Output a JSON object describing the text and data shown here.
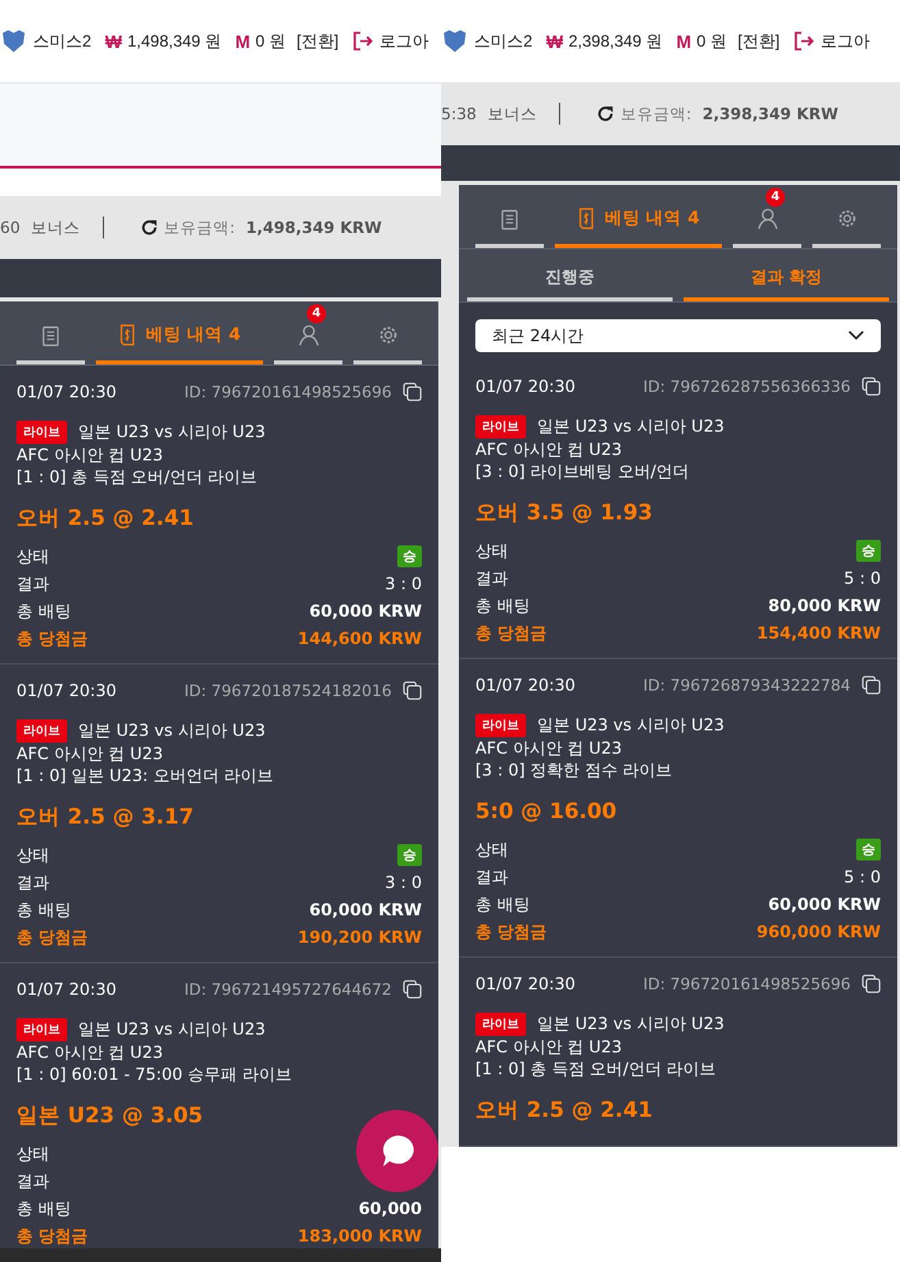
{
  "screens": [
    {
      "top_bar": {
        "username": "스미스2",
        "cash_symbol": "₩",
        "cash": "1,498,349 원",
        "point_symbol": "M",
        "points": "0 원",
        "switch": "[전환]",
        "logout": "로그아"
      },
      "balance_bar": {
        "time": "60",
        "bonus": "보너스",
        "balance_label": "보유금액:",
        "balance": "1,498,349 KRW"
      },
      "panel": {
        "tabs": [
          {
            "kind": "list",
            "selected": false
          },
          {
            "kind": "bets",
            "label": "베팅 내역 4",
            "selected": true
          },
          {
            "kind": "user",
            "badge": "4",
            "selected": false
          },
          {
            "kind": "settings",
            "selected": false
          }
        ],
        "bets": [
          {
            "date": "01/07 20:30",
            "id": "ID: 796720161498525696",
            "badge": "라이브",
            "match": "일본 U23 vs 시리아 U23",
            "league": "AFC 아시안 컵 U23",
            "market": "[1 : 0] 총 득점 오버/언더 라이브",
            "pick": "오버 2.5 @ 2.41",
            "rows": [
              {
                "kind": "status",
                "label": "상태",
                "value": "승"
              },
              {
                "kind": "plain",
                "label": "결과",
                "value": "3 : 0"
              },
              {
                "kind": "strong",
                "label": "총 배팅",
                "value": "60,000 KRW"
              },
              {
                "kind": "payout",
                "label": "총 당첨금",
                "value": "144,600 KRW"
              }
            ]
          },
          {
            "date": "01/07 20:30",
            "id": "ID: 796720187524182016",
            "badge": "라이브",
            "match": "일본 U23 vs 시리아 U23",
            "league": "AFC 아시안 컵 U23",
            "market": "[1 : 0] 일본 U23: 오버언더 라이브",
            "pick": "오버 2.5 @ 3.17",
            "rows": [
              {
                "kind": "status",
                "label": "상태",
                "value": "승"
              },
              {
                "kind": "plain",
                "label": "결과",
                "value": "3 : 0"
              },
              {
                "kind": "strong",
                "label": "총 배팅",
                "value": "60,000 KRW"
              },
              {
                "kind": "payout",
                "label": "총 당첨금",
                "value": "190,200 KRW"
              }
            ]
          },
          {
            "date": "01/07 20:30",
            "id": "ID: 796721495727644672",
            "badge": "라이브",
            "match": "일본 U23 vs 시리아 U23",
            "league": "AFC 아시안 컵 U23",
            "market": "[1 : 0] 60:01 - 75:00 승무패 라이브",
            "pick": "일본 U23 @ 3.05",
            "rows": [
              {
                "kind": "status",
                "label": "상태"
              },
              {
                "kind": "plain",
                "label": "결과"
              },
              {
                "kind": "strong",
                "label": "총 배팅",
                "value": "60,000"
              },
              {
                "kind": "payout",
                "label": "총 당첨금",
                "value": "183,000 KRW"
              }
            ]
          }
        ]
      }
    },
    {
      "top_bar": {
        "username": "스미스2",
        "cash_symbol": "₩",
        "cash": "2,398,349 원",
        "point_symbol": "M",
        "points": "0 원",
        "switch": "[전환]",
        "logout": "로그아"
      },
      "balance_bar": {
        "time": "5:38",
        "bonus": "보너스",
        "balance_label": "보유금액:",
        "balance": "2,398,349 KRW"
      },
      "panel": {
        "tabs": [
          {
            "kind": "list",
            "selected": false
          },
          {
            "kind": "bets",
            "label": "베팅 내역 4",
            "selected": true
          },
          {
            "kind": "user",
            "badge": "4",
            "selected": false
          },
          {
            "kind": "settings",
            "selected": false
          }
        ],
        "subtabs": [
          {
            "label": "진행중",
            "selected": false
          },
          {
            "label": "결과 확정",
            "selected": true
          }
        ],
        "filter": "최근 24시간",
        "bets": [
          {
            "date": "01/07 20:30",
            "id": "ID: 796726287556366336",
            "badge": "라이브",
            "match": "일본 U23 vs 시리아 U23",
            "league": "AFC 아시안 컵 U23",
            "market": "[3 : 0] 라이브베팅 오버/언더",
            "pick": "오버 3.5 @ 1.93",
            "rows": [
              {
                "kind": "status",
                "label": "상태",
                "value": "승"
              },
              {
                "kind": "plain",
                "label": "결과",
                "value": "5 : 0"
              },
              {
                "kind": "strong",
                "label": "총 배팅",
                "value": "80,000 KRW"
              },
              {
                "kind": "payout",
                "label": "총 당첨금",
                "value": "154,400 KRW"
              }
            ]
          },
          {
            "date": "01/07 20:30",
            "id": "ID: 796726879343222784",
            "badge": "라이브",
            "match": "일본 U23 vs 시리아 U23",
            "league": "AFC 아시안 컵 U23",
            "market": "[3 : 0] 정확한 점수 라이브",
            "pick": "5:0 @ 16.00",
            "rows": [
              {
                "kind": "status",
                "label": "상태",
                "value": "승"
              },
              {
                "kind": "plain",
                "label": "결과",
                "value": "5 : 0"
              },
              {
                "kind": "strong",
                "label": "총 배팅",
                "value": "60,000 KRW"
              },
              {
                "kind": "payout",
                "label": "총 당첨금",
                "value": "960,000 KRW"
              }
            ]
          },
          {
            "date": "01/07 20:30",
            "id": "ID: 796720161498525696",
            "badge": "라이브",
            "match": "일본 U23 vs 시리아 U23",
            "league": "AFC 아시안 컵 U23",
            "market": "[1 : 0] 총 득점 오버/언더 라이브",
            "pick": "오버 2.5 @ 2.41"
          }
        ]
      }
    }
  ]
}
